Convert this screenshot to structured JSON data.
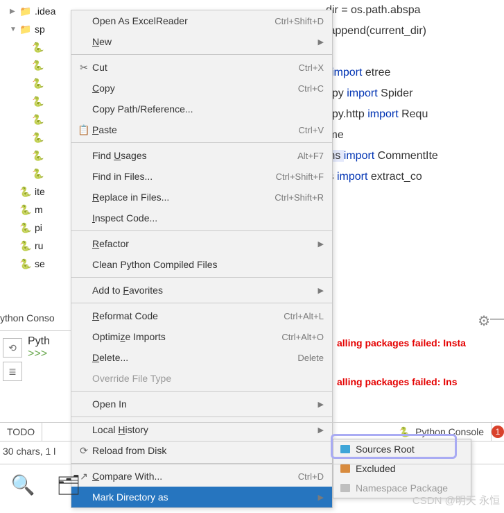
{
  "tree": {
    "items": [
      {
        "label": ".idea",
        "indent": 0,
        "icon": "folder",
        "arrow": "right"
      },
      {
        "label": "sp",
        "indent": 0,
        "icon": "folder",
        "arrow": "down"
      },
      {
        "label": "",
        "indent": 2,
        "icon": "pyfile"
      },
      {
        "label": "",
        "indent": 2,
        "icon": "pyfile"
      },
      {
        "label": "",
        "indent": 2,
        "icon": "pyfile"
      },
      {
        "label": "",
        "indent": 2,
        "icon": "pyfile"
      },
      {
        "label": "",
        "indent": 2,
        "icon": "pyfile"
      },
      {
        "label": "",
        "indent": 2,
        "icon": "pyfile"
      },
      {
        "label": "",
        "indent": 2,
        "icon": "pyfile"
      },
      {
        "label": "",
        "indent": 2,
        "icon": "pyfile"
      },
      {
        "label": "ite",
        "indent": 1,
        "icon": "pyfile"
      },
      {
        "label": "m",
        "indent": 1,
        "icon": "pyfile"
      },
      {
        "label": "pi",
        "indent": 1,
        "icon": "pyfile"
      },
      {
        "label": "ru",
        "indent": 1,
        "icon": "pyfile"
      },
      {
        "label": "se",
        "indent": 1,
        "icon": "pyfile"
      }
    ]
  },
  "menu": {
    "items": [
      {
        "label": "Open As ExcelReader",
        "shortcut": "Ctrl+Shift+D",
        "u": null
      },
      {
        "label": "New",
        "arrow": true,
        "u": "N"
      },
      {
        "sep": true
      },
      {
        "label": "Cut",
        "shortcut": "Ctrl+X",
        "icon": "cut",
        "u": null
      },
      {
        "label": "Copy",
        "shortcut": "Ctrl+C",
        "u": "C"
      },
      {
        "label": "Copy Path/Reference...",
        "u": null
      },
      {
        "label": "Paste",
        "shortcut": "Ctrl+V",
        "icon": "paste",
        "u": "P"
      },
      {
        "sep": true
      },
      {
        "label": "Find Usages",
        "shortcut": "Alt+F7",
        "u": "U"
      },
      {
        "label": "Find in Files...",
        "shortcut": "Ctrl+Shift+F"
      },
      {
        "label": "Replace in Files...",
        "shortcut": "Ctrl+Shift+R",
        "u": "R"
      },
      {
        "label": "Inspect Code...",
        "u": "I"
      },
      {
        "sep": true
      },
      {
        "label": "Refactor",
        "arrow": true,
        "u": "R"
      },
      {
        "label": "Clean Python Compiled Files"
      },
      {
        "sep": true
      },
      {
        "label": "Add to Favorites",
        "arrow": true,
        "u": "F"
      },
      {
        "sep": true
      },
      {
        "label": "Reformat Code",
        "shortcut": "Ctrl+Alt+L",
        "u": "R"
      },
      {
        "label": "Optimize Imports",
        "shortcut": "Ctrl+Alt+O",
        "u": "z"
      },
      {
        "label": "Delete...",
        "shortcut": "Delete",
        "u": "D"
      },
      {
        "label": "Override File Type",
        "disabled": true
      },
      {
        "sep": true
      },
      {
        "label": "Open In",
        "arrow": true
      },
      {
        "sep": true
      },
      {
        "label": "Local History",
        "arrow": true,
        "u": "H"
      },
      {
        "label": "Reload from Disk",
        "icon": "reload"
      },
      {
        "sep": true
      },
      {
        "label": "Compare With...",
        "shortcut": "Ctrl+D",
        "icon": "compare",
        "u": "C"
      },
      {
        "label": "Mark Directory as",
        "arrow": true,
        "selected": true
      }
    ]
  },
  "submenu": {
    "items": [
      {
        "label": "Sources Root",
        "color": "#3ea5d8"
      },
      {
        "label": "Excluded",
        "color": "#d88b3e"
      },
      {
        "label": "Namespace Package",
        "color": "#bfbfbf",
        "dim": true
      }
    ]
  },
  "code": {
    "lines": [
      {
        "pre": "dir = os.path.abspa"
      },
      {
        "pre": ".append(current_dir)",
        "kw": ""
      },
      {
        "pre": ""
      },
      {
        "pre": ""
      },
      {
        "pre": "e"
      },
      {
        "pre": "l ",
        "kw": "import",
        "post": " etree"
      },
      {
        "pre": "apy ",
        "kw": "import",
        "post": " Spider"
      },
      {
        "pre": "apy.http ",
        "kw": "import",
        "post": " Requ"
      },
      {
        "pre": "ime"
      },
      {
        "pre": "ms ",
        "kw": "import",
        "post": " CommentIte",
        "hl": true
      },
      {
        "pre": "ls ",
        "kw": "import",
        "post": " extract_co"
      }
    ]
  },
  "console": {
    "header": "ython Conso",
    "tab": "Pyth",
    "prompt": ">>>"
  },
  "errors": {
    "e1": "alling packages failed: Insta",
    "e2": "alling packages failed: Ins"
  },
  "tabs": {
    "todo": "TODO",
    "pyconsole": "Python Console",
    "badge": "1"
  },
  "status": {
    "text": "30 chars, 1 l"
  },
  "gear": {
    "hint": "—"
  },
  "watermark": "CSDN @明天 永恒"
}
